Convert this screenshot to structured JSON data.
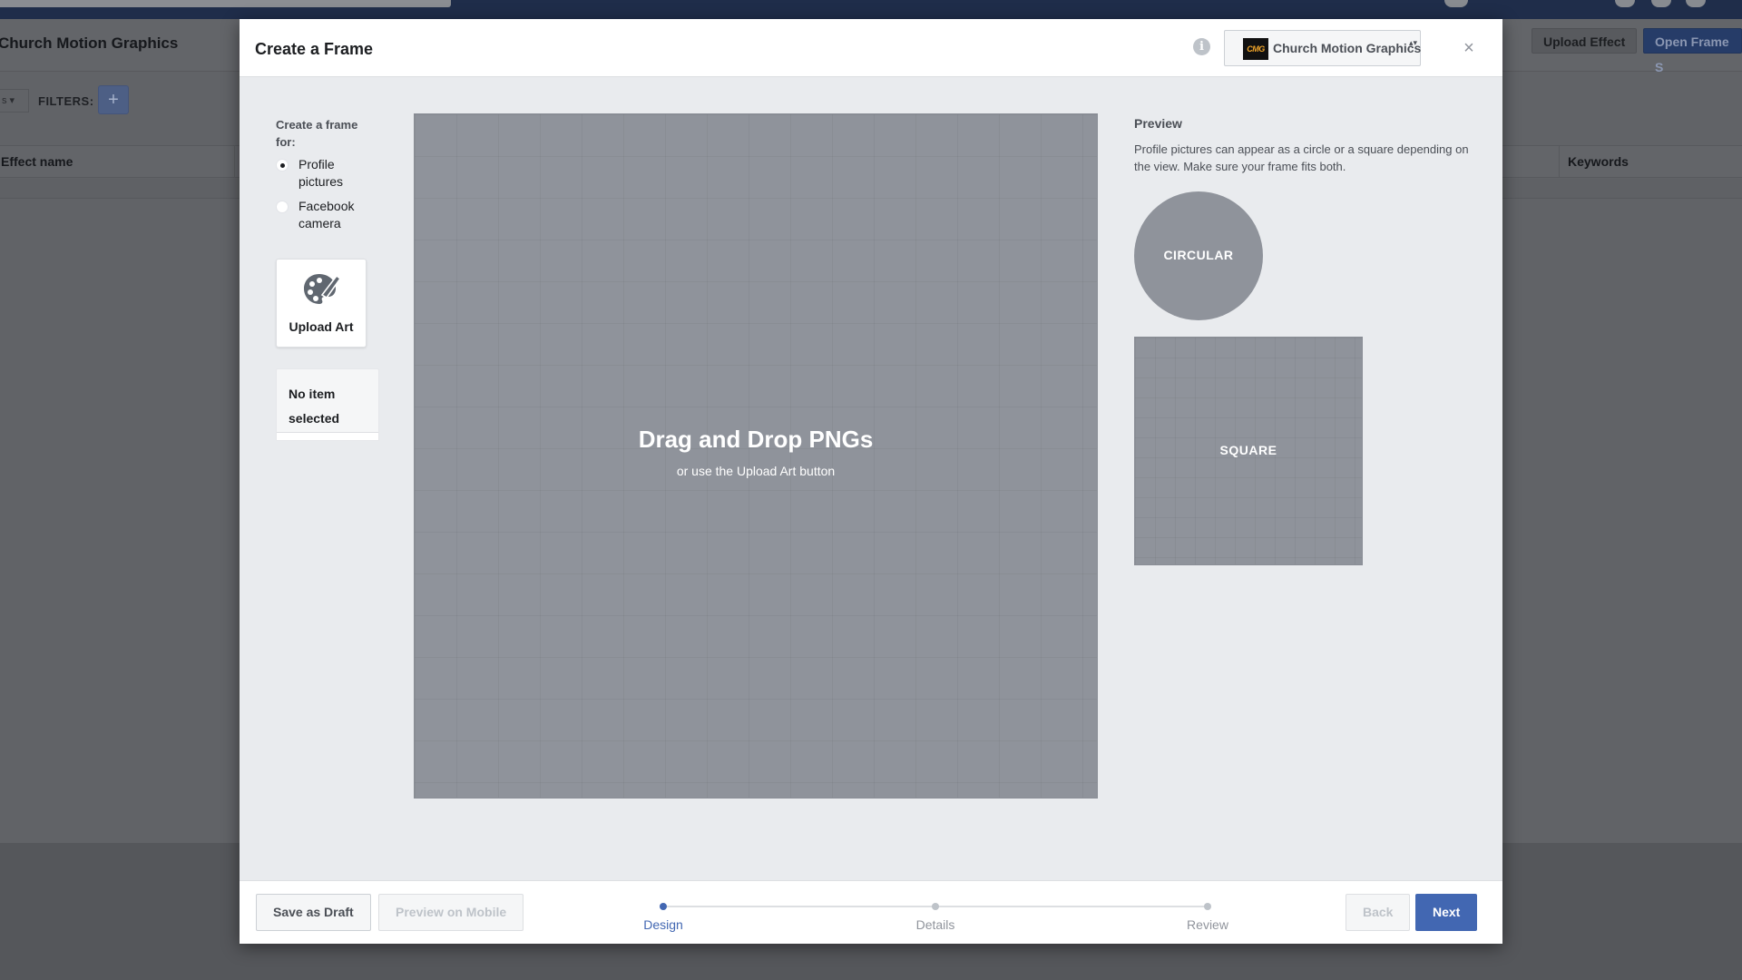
{
  "background": {
    "page_title": "Church Motion Graphics",
    "upload_effect_label": "Upload Effect",
    "open_frame_label": "Open Frame S",
    "dropdown_label": "s",
    "filters_label": "FILTERS:",
    "add_filter_label": "+",
    "columns": [
      "Effect name",
      "Keywords"
    ]
  },
  "modal": {
    "title": "Create a Frame",
    "info_icon": "i",
    "page_selector": {
      "logo_text": "CMG",
      "name": "Church Motion Graphics",
      "caret": "▴▾"
    },
    "close_icon": "×",
    "create_for": {
      "label": "Create a frame for:",
      "options": [
        {
          "label": "Profile pictures",
          "selected": true
        },
        {
          "label": "Facebook camera",
          "selected": false
        }
      ]
    },
    "upload_art": {
      "label": "Upload Art",
      "icon": "palette-icon"
    },
    "selection": {
      "empty_text": "No item selected"
    },
    "canvas": {
      "title": "Drag and Drop PNGs",
      "subtitle": "or use the Upload Art button"
    },
    "preview": {
      "title": "Preview",
      "description": "Profile pictures can appear as a circle or a square depending on the view. Make sure your frame fits both.",
      "circular_label": "CIRCULAR",
      "square_label": "SQUARE"
    },
    "footer": {
      "save_draft": "Save as Draft",
      "preview_mobile": "Preview on Mobile",
      "steps": [
        {
          "label": "Design",
          "active": true
        },
        {
          "label": "Details",
          "active": false
        },
        {
          "label": "Review",
          "active": false
        }
      ],
      "back": "Back",
      "next": "Next"
    }
  },
  "colors": {
    "accent": "#4267b2",
    "overlay": "#616367",
    "modal_bg": "#e9ebee",
    "canvas_bg": "#8f939b"
  }
}
